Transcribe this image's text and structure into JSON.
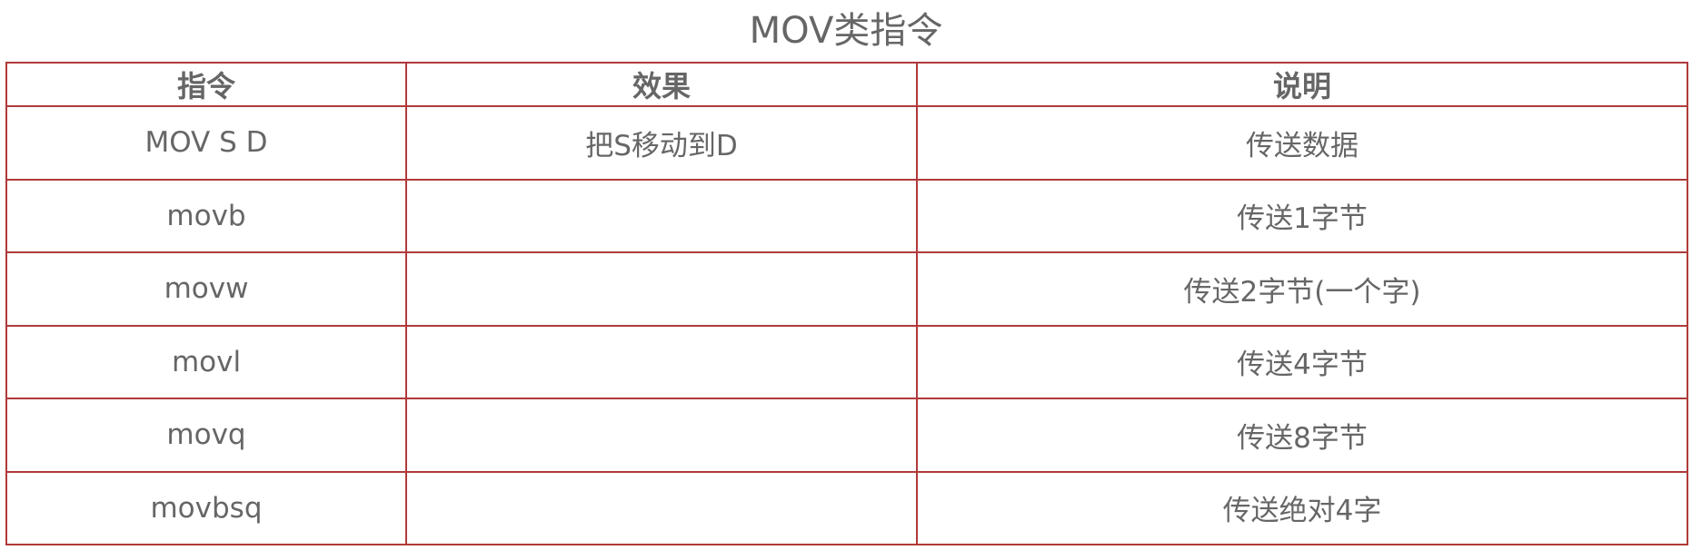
{
  "caption": "MOV类指令",
  "table": {
    "headers": [
      "指令",
      "效果",
      "说明"
    ],
    "rows": [
      [
        "MOV S D",
        "把S移动到D",
        "传送数据"
      ],
      [
        "movb",
        "",
        "传送1字节"
      ],
      [
        "movw",
        "",
        "传送2字节(一个字)"
      ],
      [
        "movl",
        "",
        "传送4字节"
      ],
      [
        "movq",
        "",
        "传送8字节"
      ],
      [
        "movbsq",
        "",
        "传送绝对4字"
      ]
    ]
  },
  "colors": {
    "border": "#b03a3a",
    "text": "#666666",
    "background": "#ffffff"
  }
}
